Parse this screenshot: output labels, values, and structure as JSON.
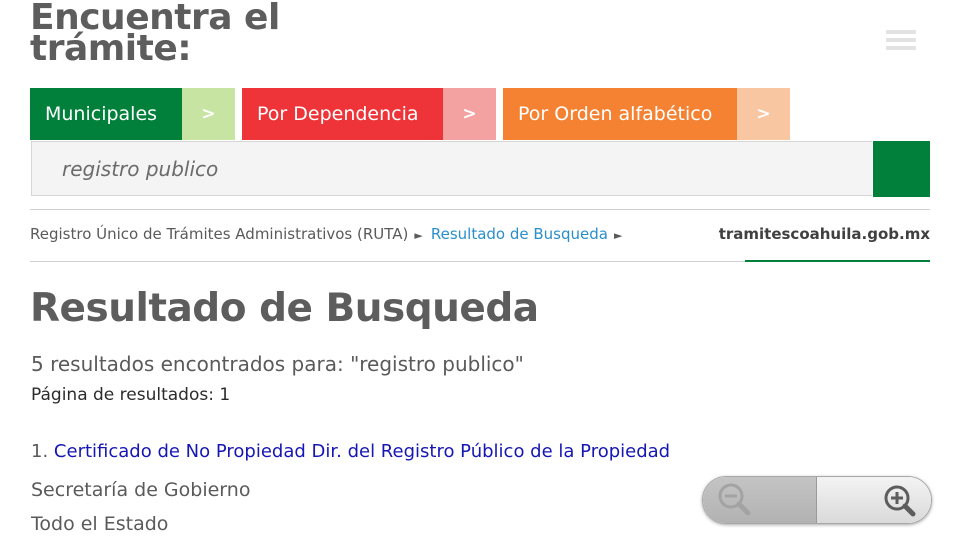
{
  "header": {
    "title": "Encuentra el trámite:",
    "menu_icon": "hamburger-menu-icon"
  },
  "filters": [
    {
      "label": "Municipales",
      "arrow": ">",
      "color": "#00803a",
      "arrow_color": "#c8e4a2"
    },
    {
      "label": "Por Dependencia",
      "arrow": ">",
      "color": "#ee3438",
      "arrow_color": "#f4a1a1"
    },
    {
      "label": "Por Orden alfabético",
      "arrow": ">",
      "color": "#f58232",
      "arrow_color": "#f8c6a0"
    }
  ],
  "search": {
    "value": "registro publico",
    "button_color": "#00803a"
  },
  "breadcrumb": {
    "items": [
      "Registro Único de Trámites Administrativos (RUTA)",
      "Resultado de Busqueda"
    ],
    "separator": "►",
    "site": "tramitescoahuila.gob.mx"
  },
  "main": {
    "title": "Resultado de Busqueda",
    "count_text": "5 resultados encontrados para: \"registro publico\"",
    "page_text": "Página de resultados: 1"
  },
  "results": [
    {
      "number": "1.",
      "title": "Certificado de No Propiedad Dir. del Registro Público de la Propiedad",
      "dependency": "Secretaría de Gobierno",
      "area": "Todo el Estado"
    }
  ],
  "zoom": {
    "out_icon": "zoom-out-icon",
    "in_icon": "zoom-in-icon"
  }
}
